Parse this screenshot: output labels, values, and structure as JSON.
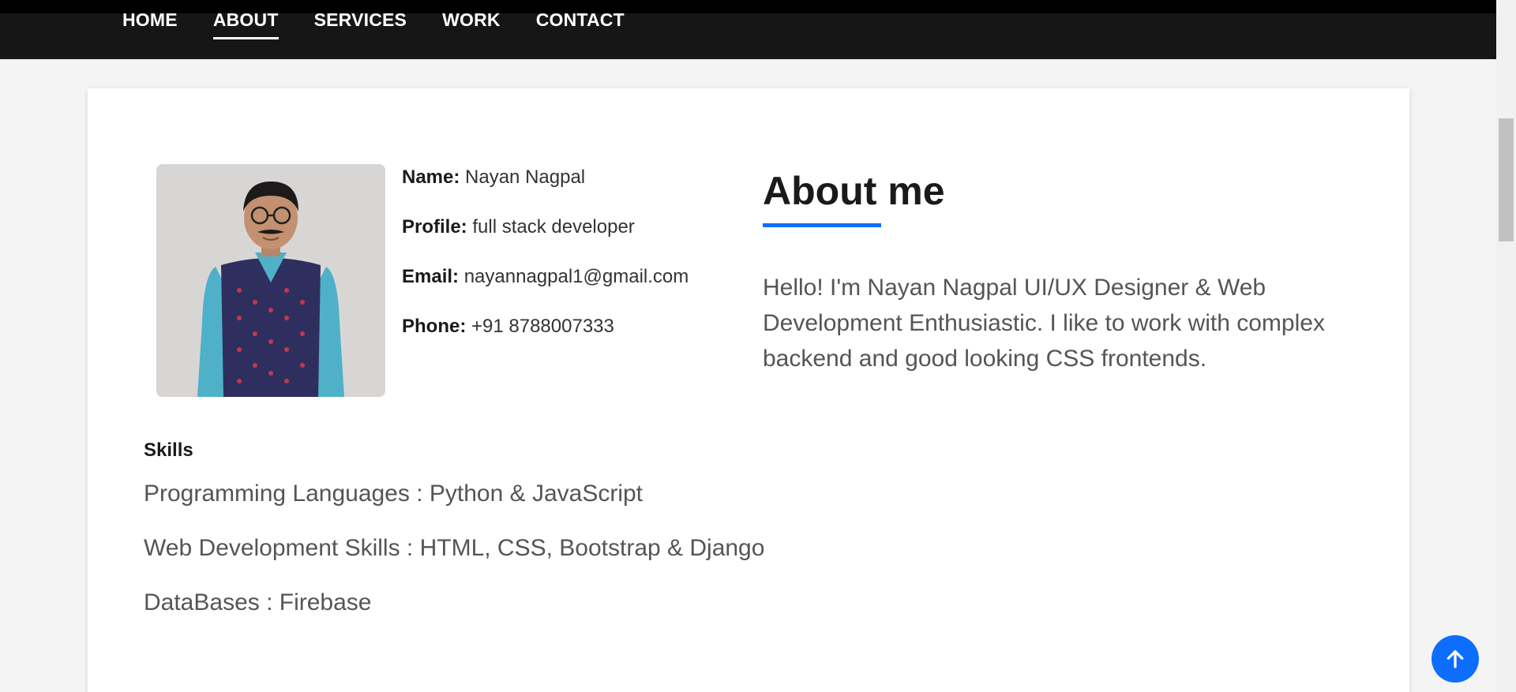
{
  "nav": {
    "items": [
      {
        "label": "HOME",
        "active": false
      },
      {
        "label": "ABOUT",
        "active": true
      },
      {
        "label": "SERVICES",
        "active": false
      },
      {
        "label": "WORK",
        "active": false
      },
      {
        "label": "CONTACT",
        "active": false
      }
    ]
  },
  "profile": {
    "photo_alt": "profile-photo",
    "fields": [
      {
        "key": "Name:",
        "value": "Nayan Nagpal"
      },
      {
        "key": "Profile:",
        "value": "full stack developer"
      },
      {
        "key": "Email:",
        "value": "nayannagpal1@gmail.com"
      },
      {
        "key": "Phone:",
        "value": "+91 8788007333"
      }
    ]
  },
  "skills": {
    "title": "Skills",
    "lines": [
      "Programming Languages : Python & JavaScript",
      "Web Development Skills : HTML, CSS, Bootstrap & Django",
      "DataBases : Firebase"
    ]
  },
  "about": {
    "heading": "About me",
    "text": "Hello! I'm Nayan Nagpal UI/UX Designer & Web Development Enthusiastic. I like to work with complex backend and good looking CSS frontends."
  },
  "colors": {
    "accent": "#0d6efd",
    "navbar": "#161616"
  },
  "icons": {
    "back_to_top": "arrow-up-icon"
  }
}
